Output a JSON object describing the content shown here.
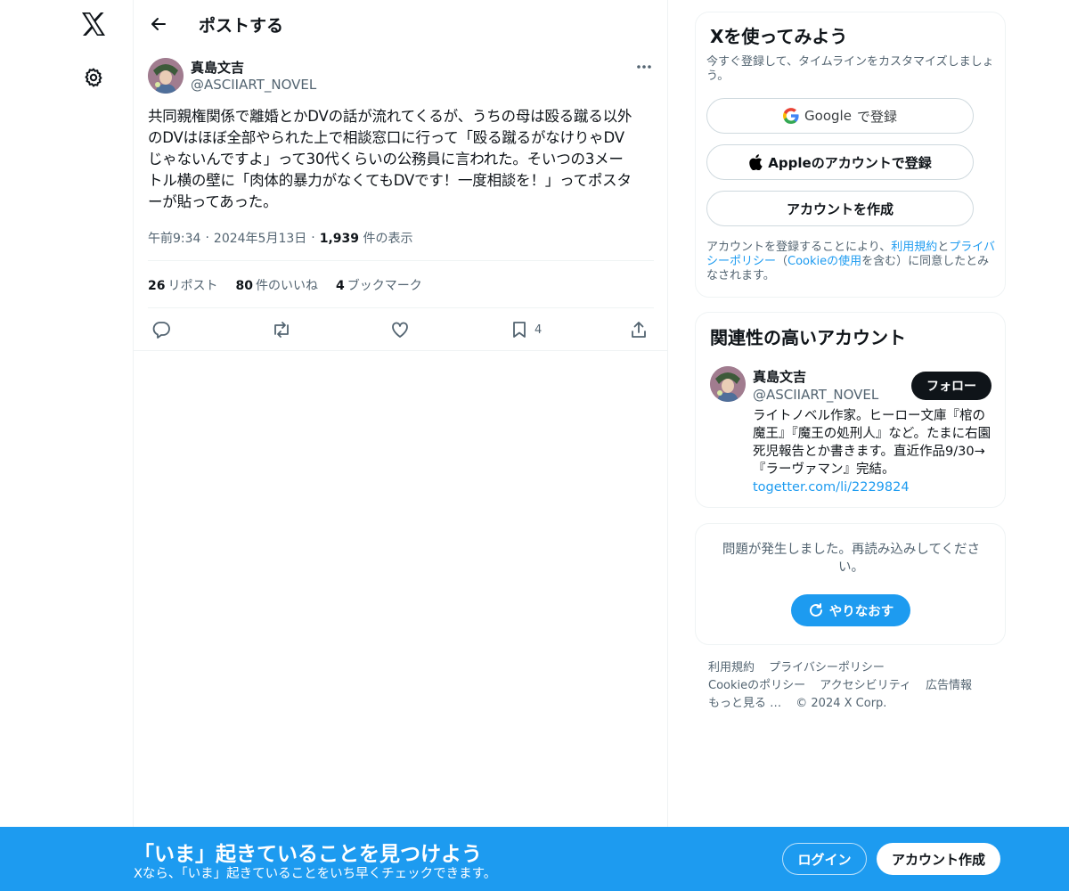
{
  "colors": {
    "accent": "#1d9bf0",
    "text": "#0f1419",
    "muted": "#536471",
    "border": "#eff3f4"
  },
  "nav": {
    "logo_icon": "x-logo-icon",
    "settings_icon": "gear-icon"
  },
  "header": {
    "title": "ポストする",
    "back_icon": "arrow-left-icon"
  },
  "post": {
    "author_name": "真島文吉",
    "author_handle": "@ASCIIART_NOVEL",
    "text": "共同親権関係で離婚とかDVの話が流れてくるが、うちの母は殴る蹴る以外\nのDVはほぼ全部やられた上で相談窓口に行って「殴る蹴るがなけりゃDV\nじゃないんですよ」って30代くらいの公務員に言われた。そいつの3メー\nトル横の壁に「肉体的暴力がなくてもDVです！一度相談を！」ってポスタ\nーが貼ってあった。",
    "time": "午前9:34",
    "date": "2024年5月13日",
    "views_count": "1,939",
    "views_label": "件の表示",
    "sep": "·",
    "reposts_count": "26",
    "reposts_label": "リポスト",
    "likes_count": "80",
    "likes_label": "件のいいね",
    "bookmarks_count": "4",
    "bookmarks_label": "ブックマーク",
    "bookmark_action_count": "4"
  },
  "signup": {
    "title": "Xを使ってみよう",
    "subtitle": "今すぐ登録して、タイムラインをカスタマイズしましょう。",
    "google_brand": "Google",
    "google_suffix": "で登録",
    "apple_label": "Appleのアカウントで登録",
    "create_label": "アカウントを作成",
    "legal_1": "アカウントを登録することにより、",
    "legal_terms": "利用規約",
    "legal_2": "と",
    "legal_privacy": "プライバシーポリシー",
    "legal_3": "（",
    "legal_cookie": "Cookieの使用",
    "legal_4": "を含む）に同意したとみなされます。"
  },
  "related": {
    "title": "関連性の高いアカウント",
    "name": "真島文吉",
    "handle": "@ASCIIART_NOVEL",
    "follow_label": "フォロー",
    "bio": "ライトノベル作家。ヒーロー文庫『棺の魔王』『魔王の処刑人』など。たまに右園死児報告とか書きます。直近作品9/30→『ラーヴァマン』完結。",
    "bio_link": "togetter.com/li/2229824"
  },
  "error": {
    "message": "問題が発生しました。再読み込みしてください。",
    "retry_label": "やりなおす"
  },
  "footer": {
    "links": [
      "利用規約",
      "プライバシーポリシー",
      "Cookieのポリシー",
      "アクセシビリティ",
      "広告情報"
    ],
    "more": "もっと見る …",
    "copyright": "© 2024 X Corp."
  },
  "banner": {
    "title": "「いま」起きていることを見つけよう",
    "subtitle": "Xなら、「いま」起きていることをいち早くチェックできます。",
    "login_label": "ログイン",
    "create_label": "アカウント作成"
  }
}
